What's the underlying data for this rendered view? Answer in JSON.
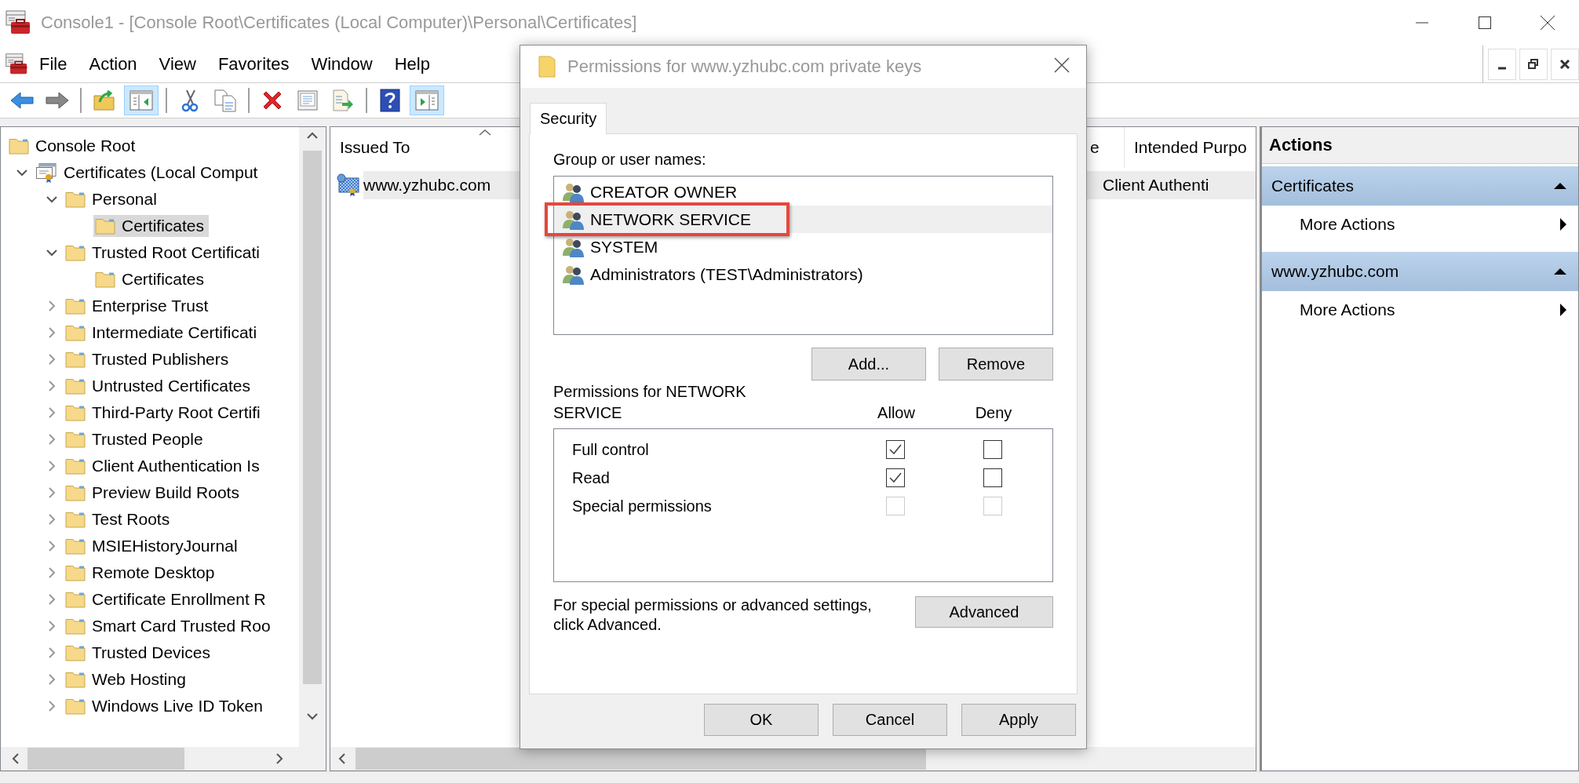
{
  "window": {
    "title": "Console1 - [Console Root\\Certificates (Local Computer)\\Personal\\Certificates]"
  },
  "menu": [
    "File",
    "Action",
    "View",
    "Favorites",
    "Window",
    "Help"
  ],
  "toolbar": [
    {
      "kind": "back",
      "pressed": false
    },
    {
      "kind": "forward",
      "pressed": false
    },
    {
      "kind": "separator"
    },
    {
      "kind": "up",
      "pressed": false
    },
    {
      "kind": "show-tree",
      "pressed": true
    },
    {
      "kind": "separator"
    },
    {
      "kind": "cut",
      "pressed": false
    },
    {
      "kind": "copy",
      "pressed": false
    },
    {
      "kind": "separator"
    },
    {
      "kind": "delete",
      "pressed": false
    },
    {
      "kind": "properties",
      "pressed": false
    },
    {
      "kind": "export",
      "pressed": false
    },
    {
      "kind": "separator"
    },
    {
      "kind": "help",
      "pressed": false
    },
    {
      "kind": "show-actions",
      "pressed": true
    }
  ],
  "tree": [
    {
      "label": "Console Root",
      "kind": "folder",
      "selected": false,
      "children": [
        {
          "label": "Certificates (Local Comput",
          "kind": "store",
          "expanded": true,
          "selected": false,
          "children": [
            {
              "label": "Personal",
              "kind": "folder",
              "expanded": true,
              "selected": false,
              "children": [
                {
                  "label": "Certificates",
                  "kind": "folder",
                  "selected": true
                }
              ]
            },
            {
              "label": "Trusted Root Certificati",
              "kind": "folder",
              "expanded": true,
              "selected": false,
              "children": [
                {
                  "label": "Certificates",
                  "kind": "folder",
                  "selected": false
                }
              ]
            },
            {
              "label": "Enterprise Trust",
              "kind": "folder",
              "expanded": false,
              "selected": false
            },
            {
              "label": "Intermediate Certificati",
              "kind": "folder",
              "expanded": false,
              "selected": false
            },
            {
              "label": "Trusted Publishers",
              "kind": "folder",
              "expanded": false,
              "selected": false
            },
            {
              "label": "Untrusted Certificates",
              "kind": "folder",
              "expanded": false,
              "selected": false
            },
            {
              "label": "Third-Party Root Certifi",
              "kind": "folder",
              "expanded": false,
              "selected": false
            },
            {
              "label": "Trusted People",
              "kind": "folder",
              "expanded": false,
              "selected": false
            },
            {
              "label": "Client Authentication Is",
              "kind": "folder",
              "expanded": false,
              "selected": false
            },
            {
              "label": "Preview Build Roots",
              "kind": "folder",
              "expanded": false,
              "selected": false
            },
            {
              "label": "Test Roots",
              "kind": "folder",
              "expanded": false,
              "selected": false
            },
            {
              "label": "MSIEHistoryJournal",
              "kind": "folder",
              "expanded": false,
              "selected": false
            },
            {
              "label": "Remote Desktop",
              "kind": "folder",
              "expanded": false,
              "selected": false
            },
            {
              "label": "Certificate Enrollment R",
              "kind": "folder",
              "expanded": false,
              "selected": false
            },
            {
              "label": "Smart Card Trusted Roo",
              "kind": "folder",
              "expanded": false,
              "selected": false
            },
            {
              "label": "Trusted Devices",
              "kind": "folder",
              "expanded": false,
              "selected": false
            },
            {
              "label": "Web Hosting",
              "kind": "folder",
              "expanded": false,
              "selected": false
            },
            {
              "label": "Windows Live ID Token",
              "kind": "folder",
              "expanded": false,
              "selected": false
            }
          ]
        }
      ]
    }
  ],
  "table": {
    "columns": [
      "Issued To",
      "e",
      "Intended Purpo"
    ],
    "rows": [
      {
        "issued_to": "www.yzhubc.com",
        "intended_purpose": "Client Authenti",
        "selected": true
      }
    ]
  },
  "actions": {
    "title": "Actions",
    "sections": [
      {
        "title": "Certificates",
        "expanded": true,
        "items": [
          "More Actions"
        ]
      },
      {
        "title": "www.yzhubc.com",
        "expanded": true,
        "items": [
          "More Actions"
        ]
      }
    ]
  },
  "dialog": {
    "title": "Permissions for www.yzhubc.com private keys",
    "tabs": [
      {
        "label": "Security",
        "selected": true
      }
    ],
    "group_label": "Group or user names:",
    "users": [
      {
        "name": "CREATOR OWNER",
        "selected": false,
        "annotated": false
      },
      {
        "name": "NETWORK SERVICE",
        "selected": true,
        "annotated": true
      },
      {
        "name": "SYSTEM",
        "selected": false,
        "annotated": false
      },
      {
        "name": "Administrators (TEST\\Administrators)",
        "selected": false,
        "annotated": false
      }
    ],
    "user_buttons": [
      "Add...",
      "Remove"
    ],
    "permissions_label": "Permissions for NETWORK SERVICE",
    "allow_label": "Allow",
    "deny_label": "Deny",
    "permissions": [
      {
        "name": "Full control",
        "allow": {
          "checked": true,
          "disabled": false
        },
        "deny": {
          "checked": false,
          "disabled": false
        }
      },
      {
        "name": "Read",
        "allow": {
          "checked": true,
          "disabled": false
        },
        "deny": {
          "checked": false,
          "disabled": false
        }
      },
      {
        "name": "Special permissions",
        "allow": {
          "checked": false,
          "disabled": true
        },
        "deny": {
          "checked": false,
          "disabled": true
        }
      }
    ],
    "advanced_text": "For special permissions or advanced settings, click Advanced.",
    "advanced_button": "Advanced",
    "buttons": [
      "OK",
      "Cancel",
      "Apply"
    ]
  }
}
